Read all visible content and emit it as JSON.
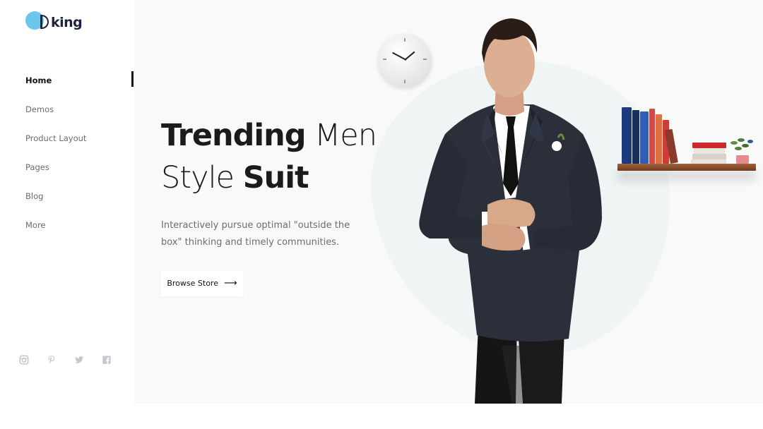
{
  "brand": {
    "name": "king",
    "accent": "#6cc7ea"
  },
  "nav": {
    "items": [
      {
        "label": "Home",
        "active": true
      },
      {
        "label": "Demos"
      },
      {
        "label": "Product Layout"
      },
      {
        "label": "Pages"
      },
      {
        "label": "Blog"
      },
      {
        "label": "More"
      }
    ]
  },
  "socials": [
    "instagram-icon",
    "pinterest-icon",
    "twitter-icon",
    "facebook-icon"
  ],
  "hero": {
    "title_bold_1": "Trending",
    "title_light_1": " Men",
    "title_light_2": "Style ",
    "title_bold_2": "Suit",
    "description": "Interactively pursue optimal \"outside the box\" thinking and timely communities.",
    "button_label": "Browse Store"
  }
}
